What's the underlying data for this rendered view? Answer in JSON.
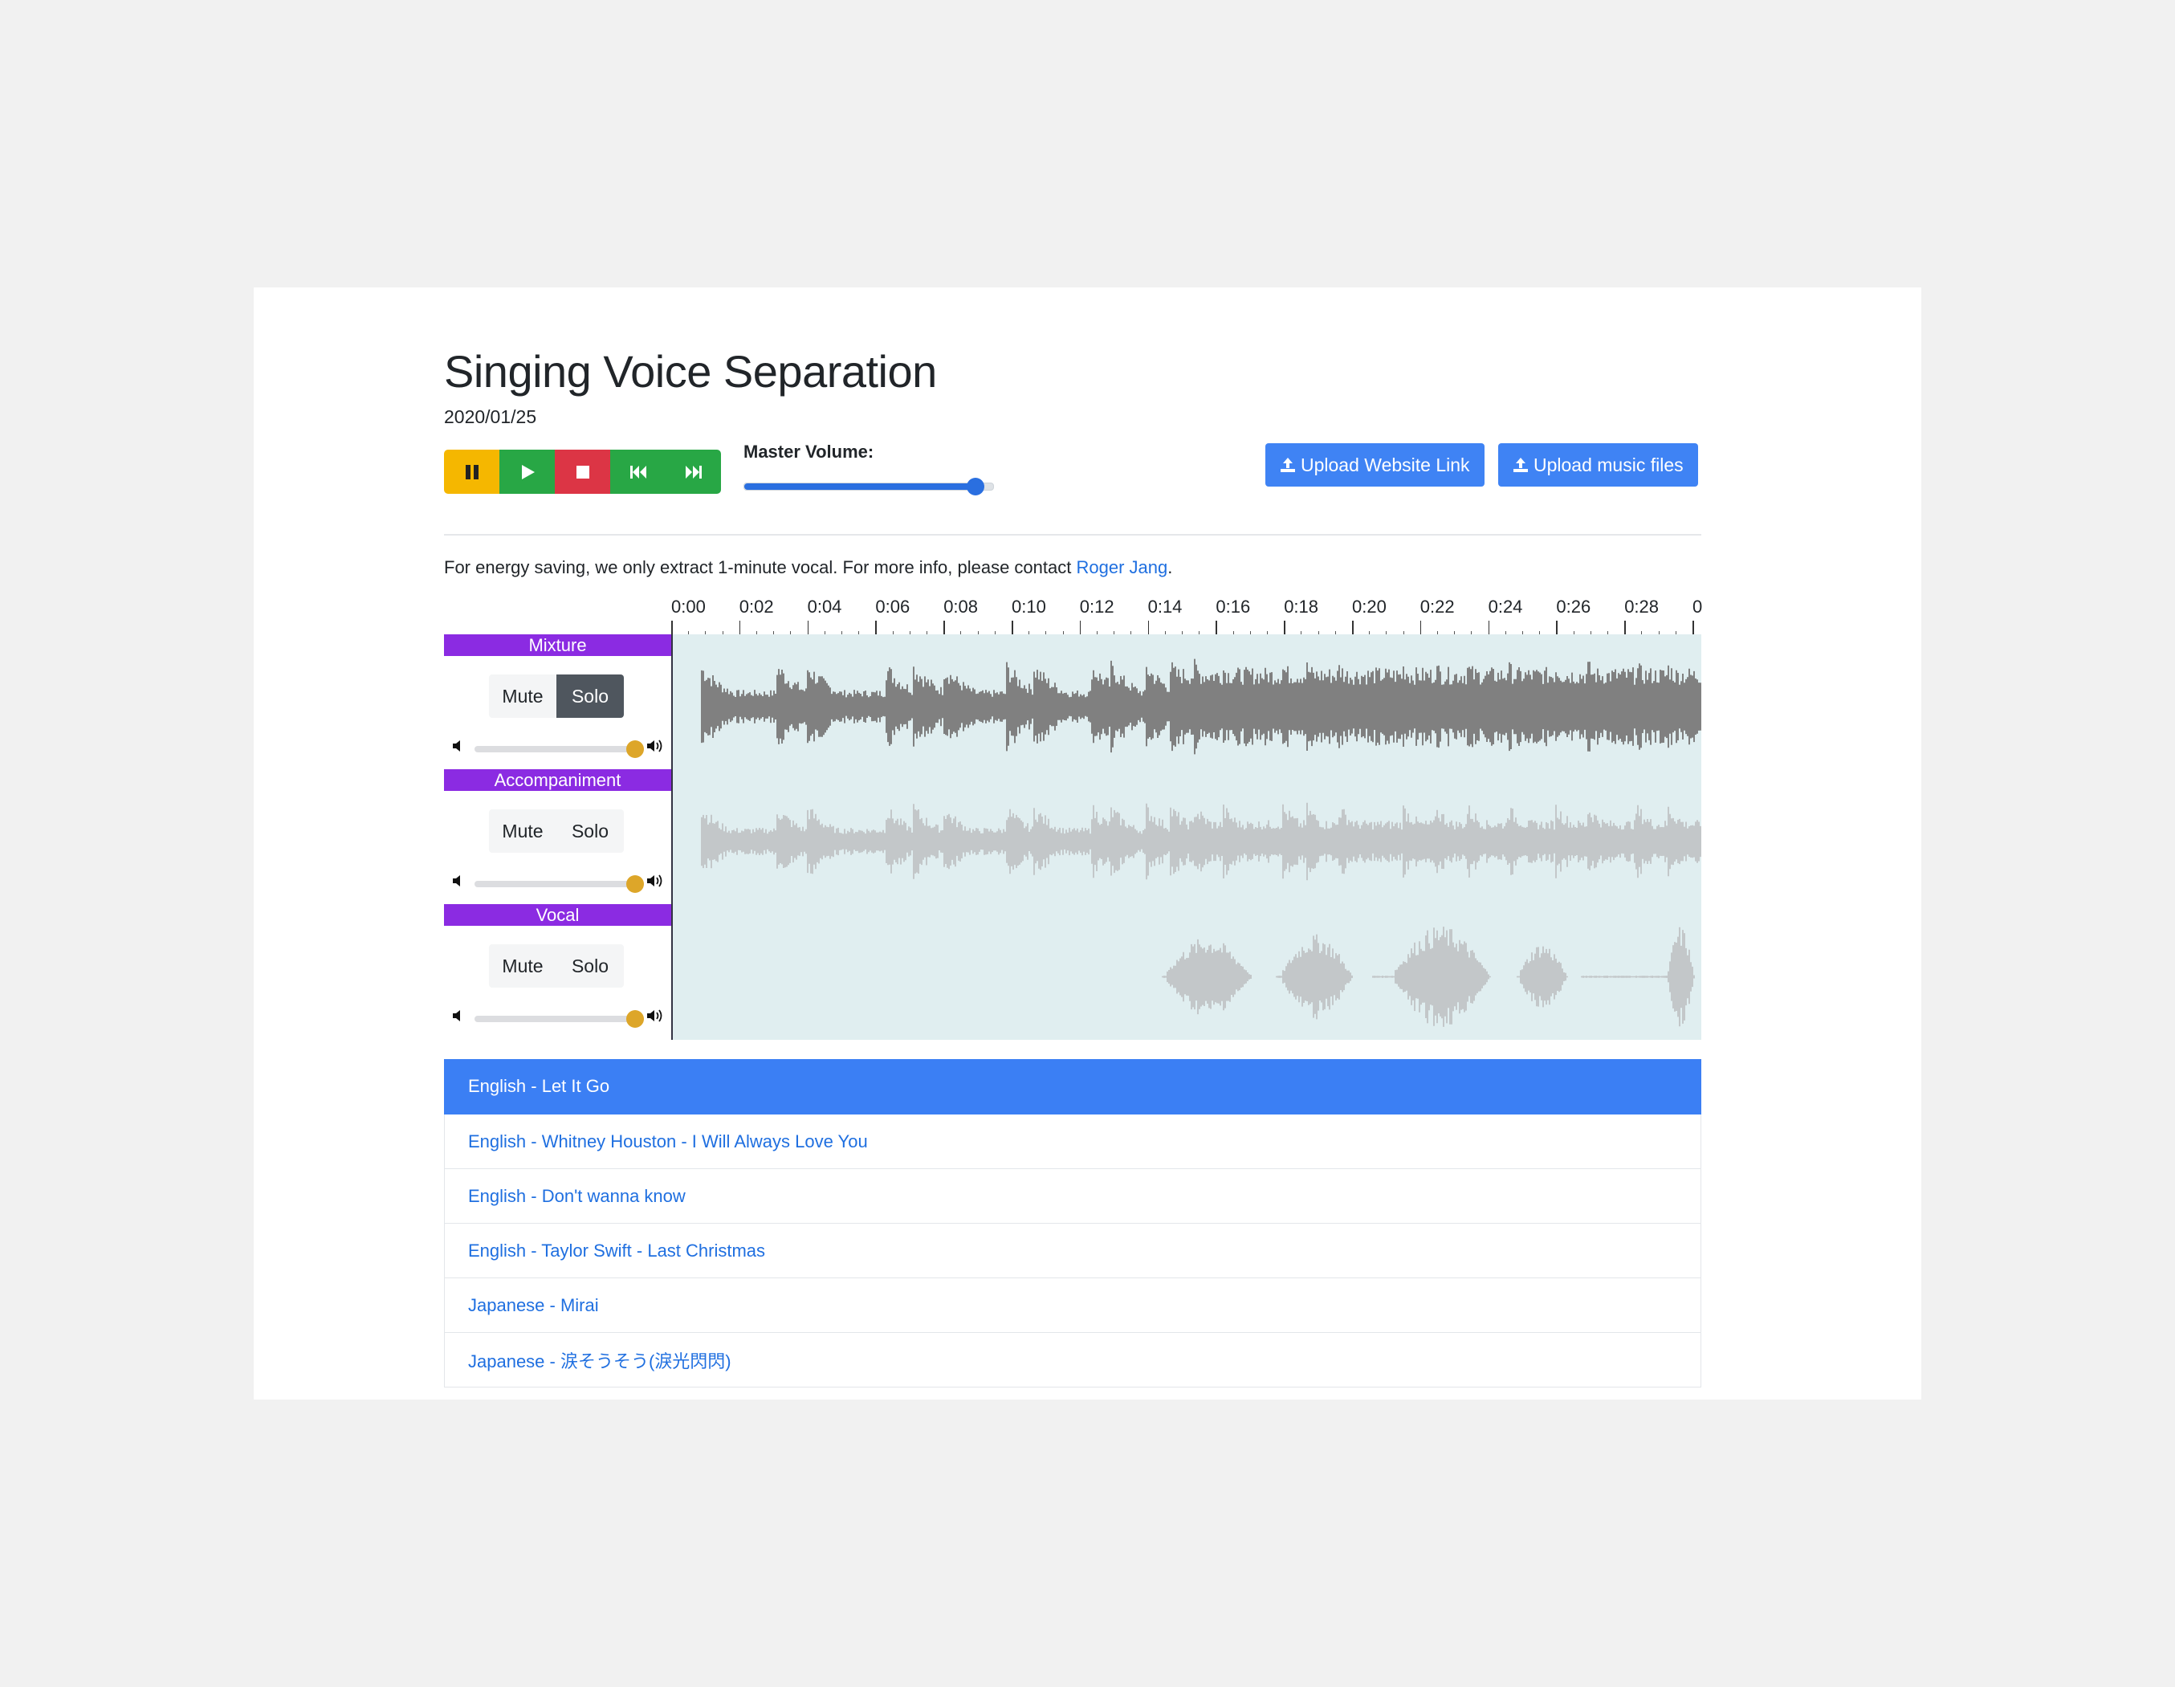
{
  "page": {
    "title": "Singing Voice Separation",
    "date": "2020/01/25",
    "info_text": "For energy saving, we only extract 1-minute vocal. For more info, please contact ",
    "info_link": "Roger Jang",
    "info_suffix": "."
  },
  "transport": {
    "buttons": [
      {
        "name": "pause",
        "color": "#f5b700"
      },
      {
        "name": "play",
        "color": "#28a745"
      },
      {
        "name": "stop",
        "color": "#dc3545"
      },
      {
        "name": "skip-back",
        "color": "#28a745"
      },
      {
        "name": "skip-forward",
        "color": "#28a745"
      }
    ]
  },
  "master_volume": {
    "label": "Master Volume:",
    "value_fraction": 0.93
  },
  "upload": {
    "link_label": "Upload Website Link",
    "files_label": "Upload music files"
  },
  "timeline": {
    "labels": [
      "0:00",
      "0:02",
      "0:04",
      "0:06",
      "0:08",
      "0:10",
      "0:12",
      "0:14",
      "0:16",
      "0:18",
      "0:20",
      "0:22",
      "0:24",
      "0:26",
      "0:28",
      "0"
    ]
  },
  "tracks": [
    {
      "name": "Mixture",
      "mute_label": "Mute",
      "solo_label": "Solo",
      "solo_active": true,
      "volume_fraction": 1.0,
      "wave_color": "#808080"
    },
    {
      "name": "Accompaniment",
      "mute_label": "Mute",
      "solo_label": "Solo",
      "solo_active": false,
      "volume_fraction": 1.0,
      "wave_color": "#c3c7c9"
    },
    {
      "name": "Vocal",
      "mute_label": "Mute",
      "solo_label": "Solo",
      "solo_active": false,
      "volume_fraction": 1.0,
      "wave_color": "#c3c7c9"
    }
  ],
  "songs": [
    {
      "label": "English - Let It Go",
      "active": true
    },
    {
      "label": "English - Whitney Houston - I Will Always Love You",
      "active": false
    },
    {
      "label": "English - Don't wanna know",
      "active": false
    },
    {
      "label": "English - Taylor Swift - Last Christmas",
      "active": false
    },
    {
      "label": "Japanese - Mirai",
      "active": false
    },
    {
      "label": "Japanese - 涙そうそう(淚光閃閃)",
      "active": false
    }
  ],
  "icons": {
    "upload": "upload-icon",
    "volume_low": "volume-down-icon",
    "volume_high": "volume-up-icon"
  }
}
